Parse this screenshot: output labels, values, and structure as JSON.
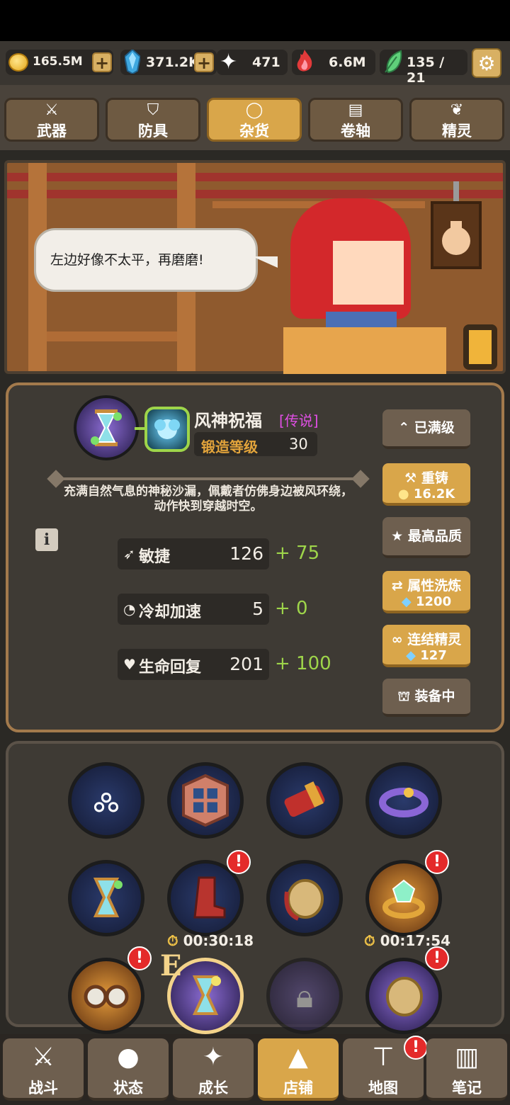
{
  "resources": {
    "gold": "165.5M",
    "gems": "371.2K",
    "stars": "471",
    "fire": "6.6M",
    "spirit": "135 / 21"
  },
  "tabs": [
    {
      "label": "武器",
      "icon": "sword-icon"
    },
    {
      "label": "防具",
      "icon": "shield-icon"
    },
    {
      "label": "杂货",
      "icon": "ring-icon",
      "active": true
    },
    {
      "label": "卷轴",
      "icon": "scroll-icon"
    },
    {
      "label": "精灵",
      "icon": "wings-icon"
    }
  ],
  "scene": {
    "speech": "左边好像不太平，再磨磨!"
  },
  "item": {
    "name": "风神祝福",
    "rarity": "[传说]",
    "forge_label": "锻造等级",
    "forge_level": "30",
    "description": "充满自然气息的神秘沙漏，佩戴者仿佛身边被风环绕，动作快到穿越时空。",
    "stats": [
      {
        "name": "敏捷",
        "value": "126",
        "bonus": "+ 75",
        "icon": "agility-icon"
      },
      {
        "name": "冷却加速",
        "value": "5",
        "bonus": "+ 0",
        "icon": "cooldown-icon"
      },
      {
        "name": "生命回复",
        "value": "201",
        "bonus": "+ 100",
        "icon": "regen-icon"
      }
    ]
  },
  "actions": {
    "max_level": "已满级",
    "recast": "重铸",
    "recast_cost": "16.2K",
    "best_quality": "最高品质",
    "reroll": "属性洗炼",
    "reroll_cost": "1200",
    "link_spirit": "连结精灵",
    "link_cost": "127",
    "equipped": "装备中"
  },
  "inventory": {
    "timers": [
      "00:30:18",
      "00:17:54"
    ],
    "equip_marker": "E"
  },
  "nav": [
    {
      "label": "战斗",
      "icon": "swords-icon"
    },
    {
      "label": "状态",
      "icon": "person-icon"
    },
    {
      "label": "成长",
      "icon": "sparkle-icon"
    },
    {
      "label": "店铺",
      "icon": "tent-icon",
      "active": true
    },
    {
      "label": "地图",
      "icon": "signpost-icon"
    },
    {
      "label": "笔记",
      "icon": "book-icon"
    }
  ],
  "colors": {
    "accent_gold": "#d9a64a",
    "legendary": "#e04fe4",
    "bonus_green": "#9ed54a",
    "alert_red": "#e42a2a"
  }
}
